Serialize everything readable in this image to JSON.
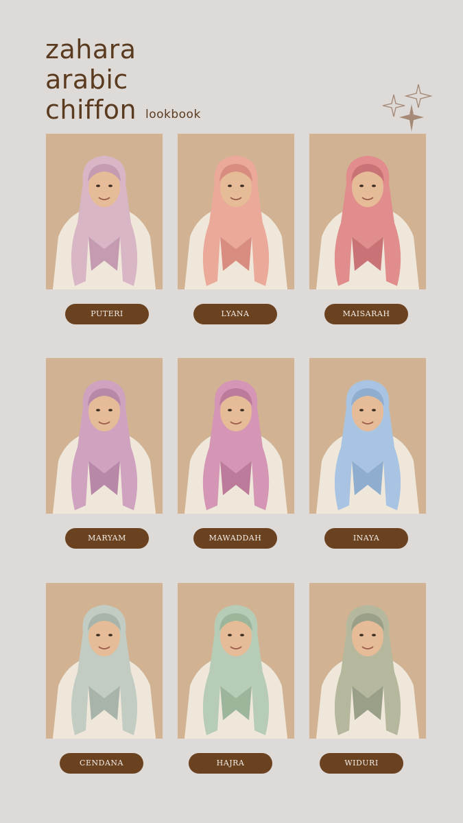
{
  "header": {
    "title_lines": [
      "zahara",
      "arabic",
      "chiffon"
    ],
    "subtitle": "lookbook",
    "sparkle_icon": "sparkles-icon",
    "text_color": "#5a3b1f",
    "sparkle_color": "#a68a78"
  },
  "lookbook": {
    "card_background": "#d1b393",
    "label_background": "#6b4220",
    "items": [
      {
        "name": "PUTERI",
        "scarf_color": "#d9b6c6",
        "shadow_color": "#c49bb0"
      },
      {
        "name": "LYANA",
        "scarf_color": "#eba99a",
        "shadow_color": "#d98d80"
      },
      {
        "name": "MAISARAH",
        "scarf_color": "#e18d8e",
        "shadow_color": "#c97376"
      },
      {
        "name": "MARYAM",
        "scarf_color": "#cfa2bf",
        "shadow_color": "#b888a8"
      },
      {
        "name": "MAWADDAH",
        "scarf_color": "#d496b4",
        "shadow_color": "#bd7b9b"
      },
      {
        "name": "INAYA",
        "scarf_color": "#a9c4e2",
        "shadow_color": "#8fadcf"
      },
      {
        "name": "CENDANA",
        "scarf_color": "#c3ccc3",
        "shadow_color": "#a8b4aa"
      },
      {
        "name": "HAJRA",
        "scarf_color": "#b7ccb6",
        "shadow_color": "#9cb59b"
      },
      {
        "name": "WIDURI",
        "scarf_color": "#b6b89e",
        "shadow_color": "#9aa088"
      }
    ]
  }
}
